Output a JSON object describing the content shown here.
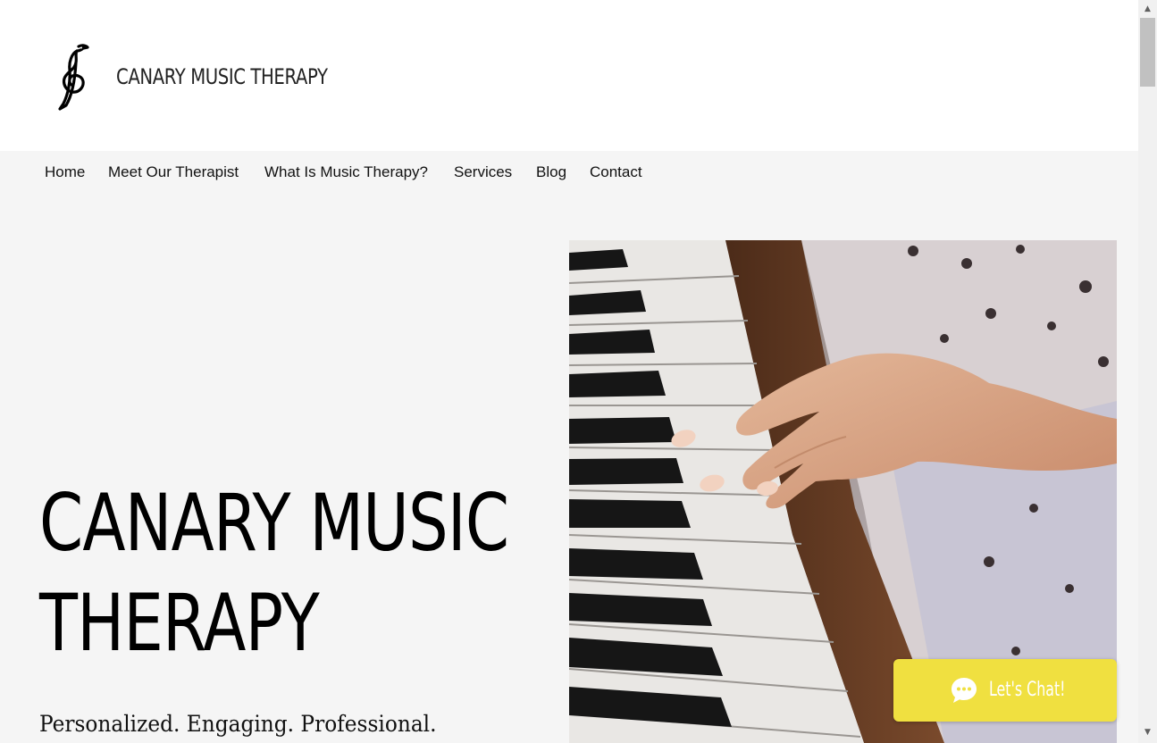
{
  "site": {
    "name": "CANARY MUSIC THERAPY",
    "logo_icon": "treble-clef-bird-logo"
  },
  "nav": {
    "items": [
      {
        "label": "Home"
      },
      {
        "label": "Meet Our Therapist"
      },
      {
        "label": "What Is Music Therapy?"
      },
      {
        "label": "Services"
      },
      {
        "label": "Blog"
      },
      {
        "label": "Contact"
      }
    ]
  },
  "hero": {
    "title_line1": "CANARY MUSIC",
    "title_line2": "THERAPY",
    "tagline": "Personalized. Engaging. Professional.",
    "image_subject": "child-hand-playing-piano-photo"
  },
  "chat": {
    "label": "Let's Chat!",
    "icon": "chat-bubble-icon",
    "color": "#f0e040"
  },
  "colors": {
    "header_bg": "#ffffff",
    "page_bg": "#f5f5f5",
    "text": "#000000"
  }
}
